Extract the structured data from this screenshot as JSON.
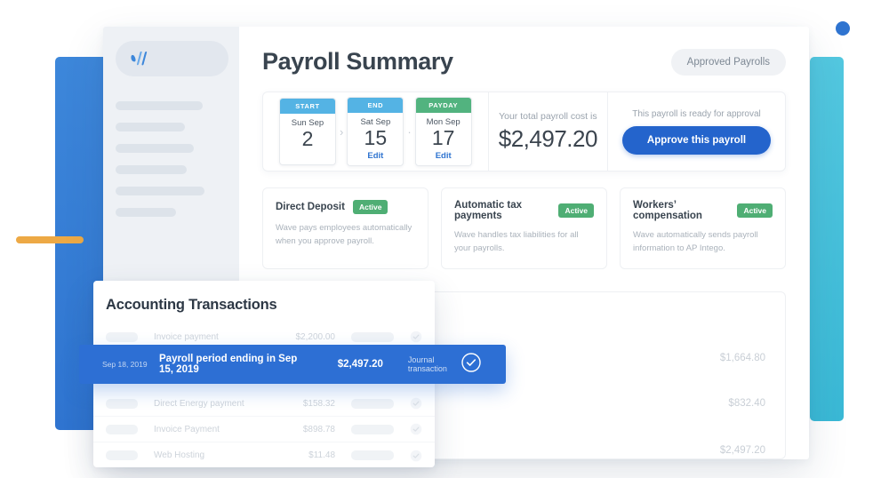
{
  "decor": {
    "blue_rect_color": "#3d87da",
    "teal_rect_color": "#4ec2dd",
    "orange_bar_color": "#eda945",
    "blue_dot_color": "#2f74d0"
  },
  "sidebar": {
    "logo": "wave-logo-icon",
    "nav_placeholder_widths": [
      98,
      78,
      88,
      80,
      100,
      68
    ]
  },
  "header": {
    "title": "Payroll Summary",
    "approved_payrolls_label": "Approved Payrolls"
  },
  "summary": {
    "dates": [
      {
        "header": "START",
        "dow": "Sun Sep",
        "day": "2",
        "edit": ""
      },
      {
        "header": "END",
        "dow": "Sat Sep",
        "day": "15",
        "edit": "Edit"
      },
      {
        "header": "PAYDAY",
        "dow": "Mon Sep",
        "day": "17",
        "edit": "Edit"
      }
    ],
    "separator_chevron": "›",
    "separator_dot": "·",
    "cost_label": "Your total payroll cost is",
    "cost_value": "$2,497.20",
    "approve_label": "This payroll is ready for approval",
    "approve_button": "Approve this payroll"
  },
  "features": [
    {
      "title": "Direct Deposit",
      "badge": "Active",
      "description": "Wave pays employees automatically when you approve payroll."
    },
    {
      "title": "Automatic tax payments",
      "badge": "Active",
      "description": "Wave handles tax liabilities for all your payrolls."
    },
    {
      "title": "Workers’ compensation",
      "badge": "Active",
      "description": "Wave automatically sends payroll information to AP Intego."
    }
  ],
  "bottom_card": {
    "amounts": [
      "$1,664.80",
      "$832.40",
      "$2,497.20"
    ]
  },
  "transactions_panel": {
    "title": "Accounting Transactions",
    "rows": [
      {
        "name": "Invoice payment",
        "amount": "$2,200.00"
      },
      {
        "name": "Direct Energy payment",
        "amount": "$158.32"
      },
      {
        "name": "Invoice Payment",
        "amount": "$898.78"
      },
      {
        "name": "Web Hosting",
        "amount": "$11.48"
      }
    ],
    "active_row": {
      "date": "Sep 18, 2019",
      "name": "Payroll period ending in Sep 15, 2019",
      "amount": "$2,497.20",
      "type": "Journal transaction",
      "check": "check-circle-icon"
    }
  }
}
